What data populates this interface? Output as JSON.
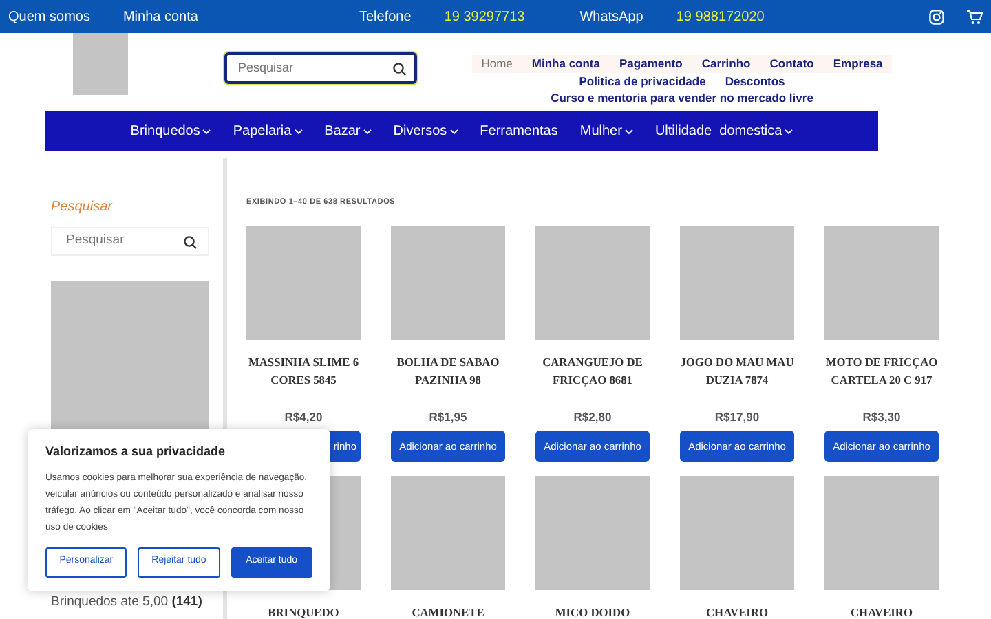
{
  "top_bar": {
    "links": [
      "Quem somos",
      "Minha conta"
    ],
    "contacts": [
      {
        "label": "Telefone",
        "value": "19 39297713"
      },
      {
        "label": "WhatsApp",
        "value": "19 988172020"
      }
    ]
  },
  "header": {
    "search": {
      "placeholder": "Pesquisar"
    },
    "menu": [
      {
        "label": "Home",
        "selected": true
      },
      {
        "label": "Minha conta",
        "selected": false
      },
      {
        "label": "Pagamento",
        "selected": false
      },
      {
        "label": "Carrinho",
        "selected": false
      },
      {
        "label": "Contato",
        "selected": false
      },
      {
        "label": "Empresa",
        "selected": false
      },
      {
        "label": "Politica de privacidade",
        "selected": false
      },
      {
        "label": "Descontos",
        "selected": false
      },
      {
        "label": "Curso e mentoria para vender no mercado livre",
        "selected": false
      }
    ]
  },
  "nav": [
    {
      "label": "Brinquedos",
      "dropdown": true
    },
    {
      "label": "Papelaria",
      "dropdown": true
    },
    {
      "label": "Bazar",
      "dropdown": true
    },
    {
      "label": "Diversos",
      "dropdown": true
    },
    {
      "label": "Ferramentas",
      "dropdown": false
    },
    {
      "label": "Mulher",
      "dropdown": true
    },
    {
      "label": "Ultilidade  domestica",
      "dropdown": true
    }
  ],
  "sidebar": {
    "title": "Pesquisar",
    "search": {
      "placeholder": "Pesquisar"
    },
    "categories": [
      {
        "name": "Brinquedos ate 5,00",
        "count": "(141)"
      }
    ]
  },
  "results": {
    "summary": "EXIBINDO 1–40 DE 638 RESULTADOS",
    "products": [
      {
        "title": "MASSINHA SLIME 6 CORES 5845",
        "price": "R$4,20",
        "button": "rinho",
        "button_covered": true
      },
      {
        "title": "BOLHA DE SABAO PAZINHA 98",
        "price": "R$1,95",
        "button": "Adicionar ao carrinho"
      },
      {
        "title": "CARANGUEJO DE FRICÇAO 8681",
        "price": "R$2,80",
        "button": "Adicionar ao carrinho"
      },
      {
        "title": "JOGO DO MAU MAU DUZIA 7874",
        "price": "R$17,90",
        "button": "Adicionar ao carrinho"
      },
      {
        "title": "MOTO DE FRICÇAO CARTELA 20 C 917",
        "price": "R$3,30",
        "button": "Adicionar ao carrinho"
      },
      {
        "title": "BRINQUEDO"
      },
      {
        "title": "CAMIONETE"
      },
      {
        "title": "MICO DOIDO"
      },
      {
        "title": "CHAVEIRO"
      },
      {
        "title": "CHAVEIRO"
      }
    ]
  },
  "cookie_banner": {
    "title": "Valorizamos a sua privacidade",
    "text": "Usamos cookies para melhorar sua experiência de navegação, veicular anúncios ou conteúdo personalizado e analisar nosso tráfego. Ao clicar em \"Aceitar tudo\", você concorda com nosso uso de cookies",
    "buttons": [
      {
        "label": "Personalizar",
        "kind": "outline"
      },
      {
        "label": "Rejeitar tudo",
        "kind": "outline"
      },
      {
        "label": "Aceitar tudo",
        "kind": "primary"
      }
    ]
  }
}
